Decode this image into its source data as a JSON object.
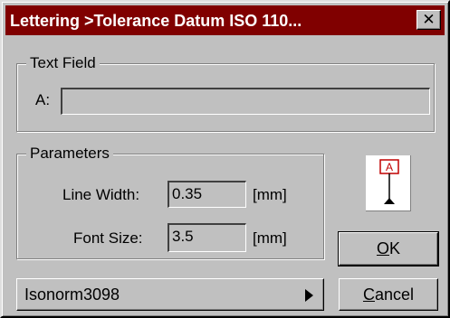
{
  "window": {
    "title": "Lettering >Tolerance Datum ISO 110...",
    "close_icon": "close-icon"
  },
  "text_field_group": {
    "legend": "Text Field",
    "label": "A:",
    "value": ""
  },
  "parameters_group": {
    "legend": "Parameters",
    "line_width": {
      "label": "Line Width:",
      "value": "0.35",
      "unit": "[mm]"
    },
    "font_size": {
      "label": "Font Size:",
      "value": "3.5",
      "unit": "[mm]"
    }
  },
  "preview": {
    "icon": "tolerance-datum-symbol-icon",
    "letter": "A",
    "colors": {
      "frame": "#c00000",
      "line": "#000000"
    }
  },
  "buttons": {
    "ok_prefix": "",
    "ok_mnemonic": "O",
    "ok_rest": "K",
    "cancel_prefix": "",
    "cancel_mnemonic": "C",
    "cancel_rest": "ancel"
  },
  "style_selector": {
    "value": "Isonorm3098",
    "arrow_icon": "triangle-right-icon"
  },
  "colors": {
    "titlebar": "#800000",
    "face": "#c0c0c0"
  }
}
